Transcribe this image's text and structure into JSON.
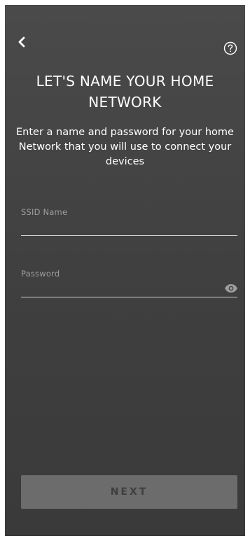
{
  "header": {
    "back_icon": "chevron-left-icon",
    "help_icon": "question-circle-icon"
  },
  "title": {
    "line1": "LET'S NAME YOUR HOME",
    "line2": "NETWORK"
  },
  "subtitle": {
    "line1": "Enter a name and password for your home",
    "line2": "Network that you will use to connect your",
    "line3": "devices"
  },
  "form": {
    "ssid": {
      "label": "SSID Name",
      "value": ""
    },
    "password": {
      "label": "Password",
      "value": "",
      "toggle_icon": "eye-icon"
    }
  },
  "actions": {
    "next_label": "NEXT"
  },
  "colors": {
    "background": "#444444",
    "text": "#ffffff",
    "label": "#9e9e9e",
    "button_bg": "#6c6c6c",
    "button_text": "#3f3f3f"
  }
}
